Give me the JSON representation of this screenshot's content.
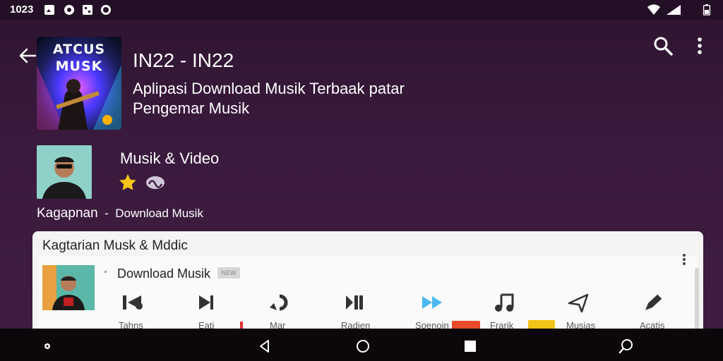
{
  "status_bar": {
    "time": "1023",
    "left_icons": [
      "image-icon",
      "settings-icon",
      "qr-icon",
      "circle-icon"
    ],
    "right_icons": [
      "wifi-icon",
      "signal-icon",
      "battery-icon"
    ]
  },
  "app_bar": {
    "back_icon": "back-arrow-icon",
    "search_icon": "search-icon",
    "more_icon": "more-vert-icon"
  },
  "header": {
    "album_art_text": "ATCUS MUSK",
    "title": "IN22 - IN22",
    "subtitle": "Aplipasi Download Musik Terbaak patar Pengemar Musik"
  },
  "category": {
    "title": "Musik & Video",
    "icons": [
      "star-icon",
      "wave-icon"
    ],
    "breadcrumb_left": "Kagapnan",
    "breadcrumb_sep": "-",
    "breadcrumb_right": "Download Musik"
  },
  "card": {
    "title": "Kagtarian Musk & Mddic",
    "track_label": "Download Musik",
    "track_badge": "NEW",
    "controls": [
      {
        "icon": "rewind-icon",
        "label": "Tahns"
      },
      {
        "icon": "skip-next-icon",
        "label": "Eati"
      },
      {
        "icon": "repeat-icon",
        "label": "Mar"
      },
      {
        "icon": "pause-icon",
        "label": "Radien"
      },
      {
        "icon": "fast-forward-icon",
        "label": "Soenoin"
      },
      {
        "icon": "music-note-icon",
        "label": "Frarik"
      },
      {
        "icon": "share-icon",
        "label": "Musias"
      },
      {
        "icon": "edit-icon",
        "label": "Acatis"
      }
    ]
  },
  "colors": {
    "background": "#3a1a3d",
    "status_bar": "#241026",
    "card": "#f4f4f4",
    "accent_blue": "#4db8f0",
    "star": "#f5c518",
    "nav_bar": "#0b070b"
  },
  "nav_bar": {
    "icons": [
      "dot-icon",
      "back-triangle-icon",
      "home-circle-icon",
      "recents-square-icon",
      "assistant-icon"
    ]
  }
}
